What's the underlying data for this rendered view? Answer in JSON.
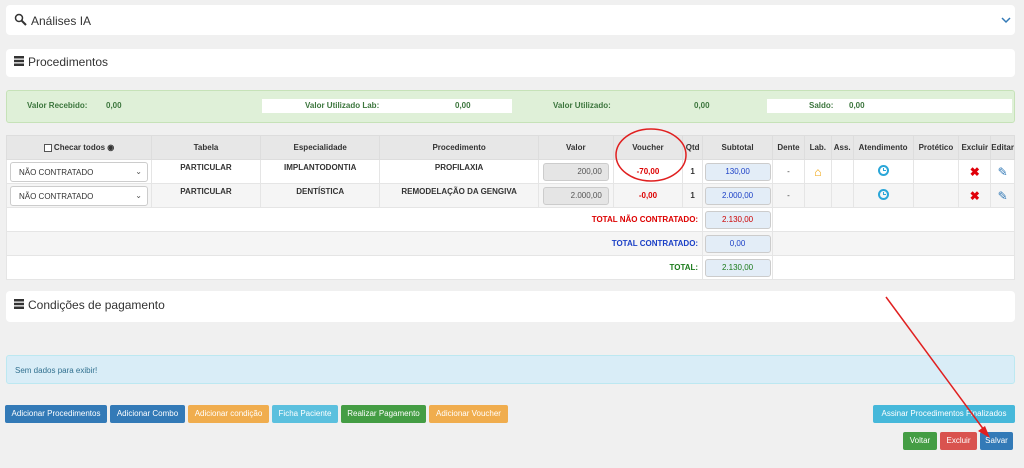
{
  "sections": {
    "analises": "Análises IA",
    "procedimentos": "Procedimentos",
    "condicoes": "Condições de pagamento"
  },
  "summary": {
    "valor_recebido_label": "Valor Recebido:",
    "valor_recebido": "0,00",
    "valor_lab_label": "Valor Utilizado Lab:",
    "valor_lab": "0,00",
    "valor_utilizado_label": "Valor Utilizado:",
    "valor_utilizado": "0,00",
    "saldo_label": "Saldo:",
    "saldo": "0,00"
  },
  "table": {
    "headers": [
      "Checar todos",
      "Tabela",
      "Especialidade",
      "Procedimento",
      "Valor",
      "Voucher",
      "Qtd",
      "Subtotal",
      "Dente",
      "Lab.",
      "Ass.",
      "Atendimento",
      "Protético",
      "Excluir",
      "Editar"
    ],
    "rows": [
      {
        "contrato": "NÃO CONTRATADO",
        "tabela": "PARTICULAR",
        "especialidade": "IMPLANTODONTIA",
        "procedimento": "PROFILAXIA",
        "valor": "200,00",
        "voucher": "-70,00",
        "qtd": "1",
        "subtotal": "130,00",
        "dente": "-"
      },
      {
        "contrato": "NÃO CONTRATADO",
        "tabela": "PARTICULAR",
        "especialidade": "DENTÍSTICA",
        "procedimento": "REMODELAÇÃO DA GENGIVA",
        "valor": "2.000,00",
        "voucher": "-0,00",
        "qtd": "1",
        "subtotal": "2.000,00",
        "dente": "-"
      }
    ],
    "totals": {
      "nao_contratado_label": "TOTAL NÃO CONTRATADO:",
      "nao_contratado": "2.130,00",
      "contratado_label": "TOTAL CONTRATADO:",
      "contratado": "0,00",
      "total_label": "TOTAL:",
      "total": "2.130,00"
    }
  },
  "nodata": "Sem dados para exibir!",
  "buttons": {
    "adicionar_procedimentos": "Adicionar Procedimentos",
    "adicionar_combo": "Adicionar Combo",
    "adicionar_condicao": "Adicionar condição",
    "ficha_paciente": "Ficha Paciente",
    "realizar_pagamento": "Realizar Pagamento",
    "adicionar_voucher": "Adicionar Voucher",
    "assinar": "Assinar Procedimentos Finalizados",
    "voltar": "Voltar",
    "excluir": "Excluir",
    "salvar": "Salvar"
  },
  "colors": {
    "annotation": "#e02020",
    "primary": "#337ab7",
    "success": "#449d44",
    "warning": "#f0ad4e",
    "danger": "#d9534f"
  }
}
